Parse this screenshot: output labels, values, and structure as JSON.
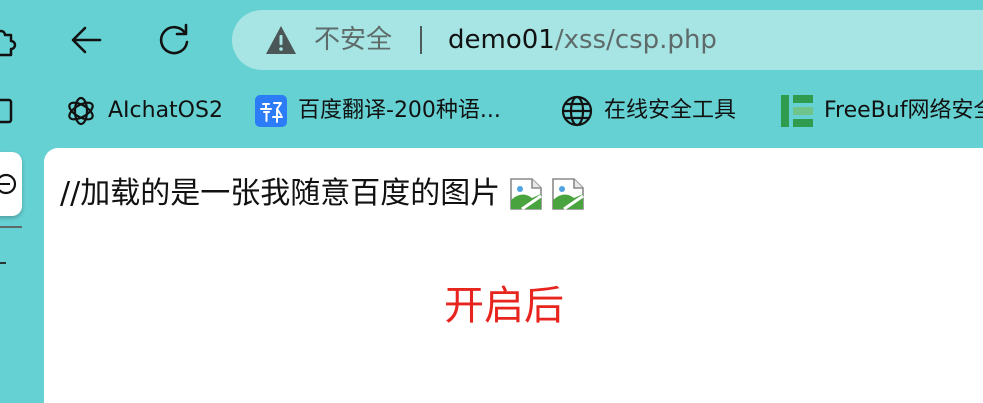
{
  "address_bar": {
    "security_status": "不安全",
    "url_host": "demo01",
    "url_path": "/xss/csp.php"
  },
  "bookmarks": [
    {
      "label": "",
      "icon": "bookmark-icon"
    },
    {
      "label": "AIchatOS2",
      "icon": "openai-logo-icon"
    },
    {
      "label": "百度翻译-200种语...",
      "icon": "baidu-translate-icon"
    },
    {
      "label": "在线安全工具",
      "icon": "globe-icon"
    },
    {
      "label": "FreeBuf网络安全",
      "icon": "freebuf-logo-icon"
    }
  ],
  "page": {
    "line_text": "//加载的是一张我随意百度的图片",
    "heading": "开启后",
    "heading_color": "#e8241e"
  },
  "colors": {
    "frame": "#66d1d3",
    "omnibox": "#a6e5e3",
    "content_bg": "#ffffff"
  }
}
